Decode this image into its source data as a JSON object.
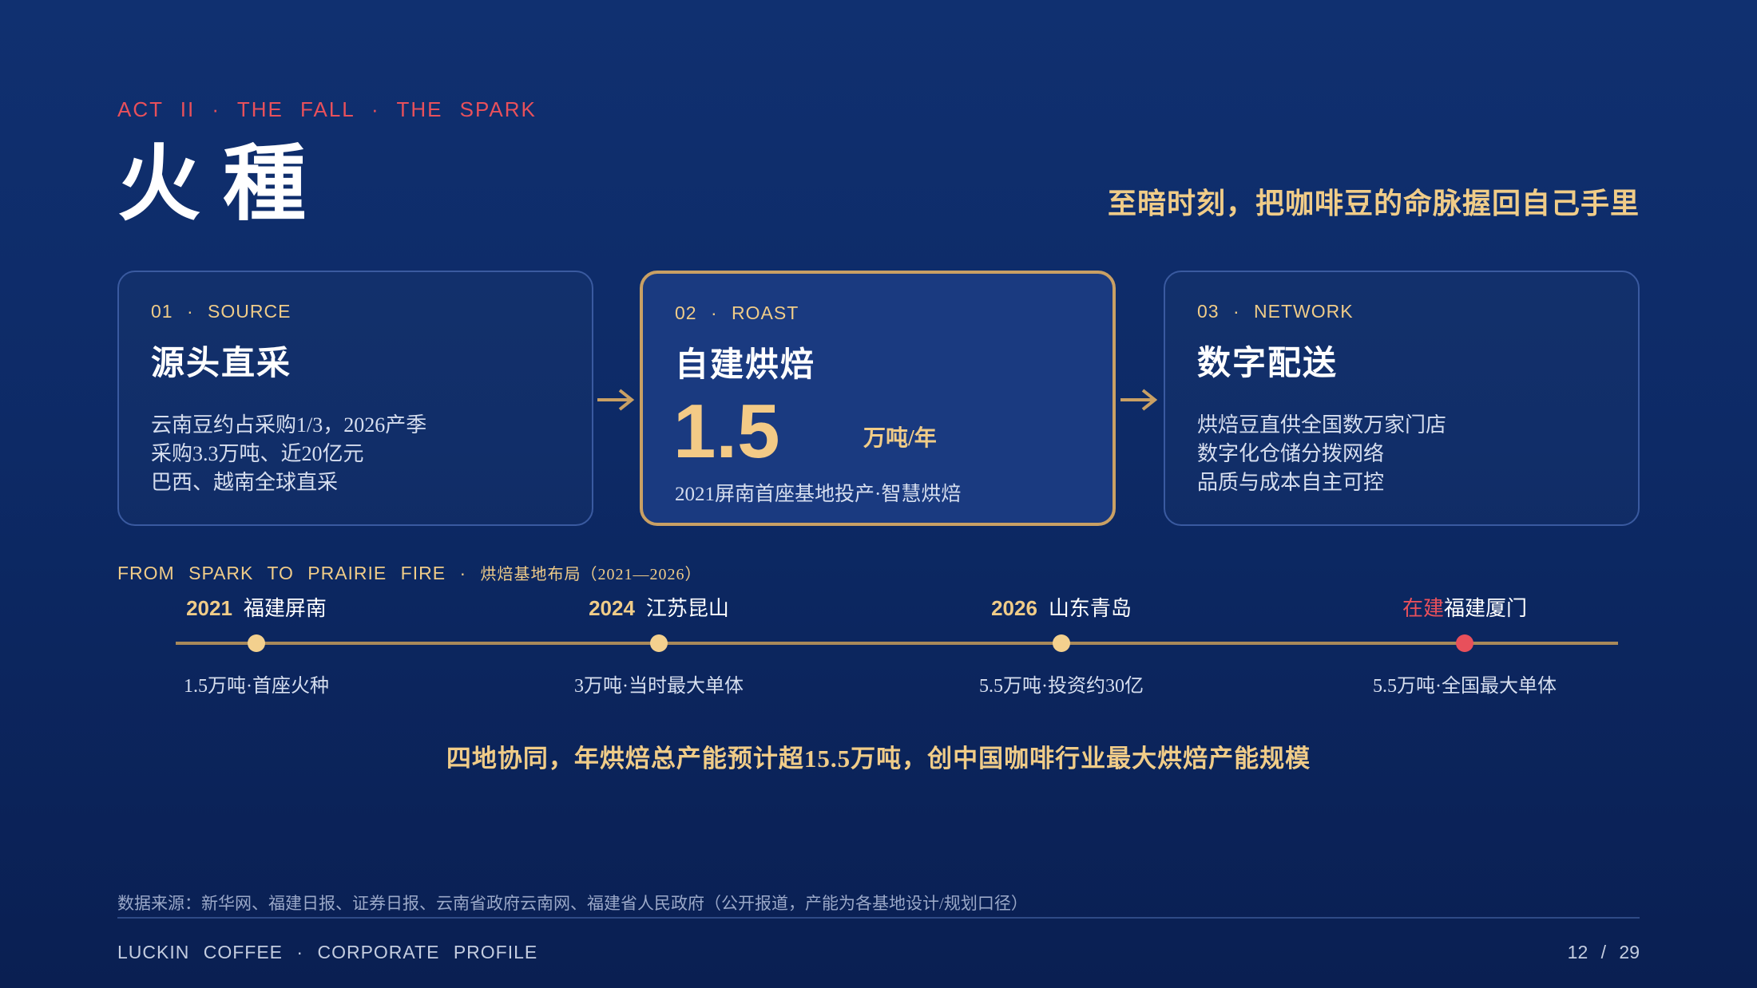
{
  "header": {
    "act": "ACT II · THE FALL · THE SPARK",
    "title": "火種",
    "tagline": "至暗时刻，把咖啡豆的命脉握回自己手里"
  },
  "cards": [
    {
      "label": "01 · SOURCE",
      "name": "源头直采",
      "lines": [
        "云南豆约占采购1/3，2026产季",
        "采购3.3万吨、近20亿元",
        "巴西、越南全球直采"
      ]
    },
    {
      "label": "02 · ROAST",
      "name": "自建烘焙",
      "big": "1.5",
      "unit": "万吨/年",
      "sub": "2021屏南首座基地投产·智慧烘焙"
    },
    {
      "label": "03 · NETWORK",
      "name": "数字配送",
      "lines": [
        "烘焙豆直供全国数万家门店",
        "数字化仓储分拨网络",
        "品质与成本自主可控"
      ]
    }
  ],
  "timeline": {
    "heading": "FROM SPARK TO PRAIRIE FIRE ·",
    "heading_cn": "烘焙基地布局（2021—2026）",
    "milestones": [
      {
        "year": "2021",
        "tag": "",
        "city": "福建屏南",
        "desc": "1.5万吨·首座火种",
        "status": "done"
      },
      {
        "year": "2024",
        "tag": "",
        "city": "江苏昆山",
        "desc": "3万吨·当时最大单体",
        "status": "done"
      },
      {
        "year": "2026",
        "tag": "",
        "city": "山东青岛",
        "desc": "5.5万吨·投资约30亿",
        "status": "done"
      },
      {
        "year": "",
        "tag": "在建",
        "city": "福建厦门",
        "desc": "5.5万吨·全国最大单体",
        "status": "building"
      }
    ]
  },
  "summary": "四地协同，年烘焙总产能预计超15.5万吨，创中国咖啡行业最大烘焙产能规模",
  "footer": {
    "source": "数据来源：新华网、福建日报、证券日报、云南省政府云南网、福建省人民政府（公开报道，产能为各基地设计/规划口径）",
    "brand": "LUCKIN COFFEE · CORPORATE PROFILE",
    "page": "12 / 29"
  },
  "colors": {
    "accent_gold": "#f0cc88",
    "accent_red": "#e8505b",
    "background": "#0d2a66"
  }
}
